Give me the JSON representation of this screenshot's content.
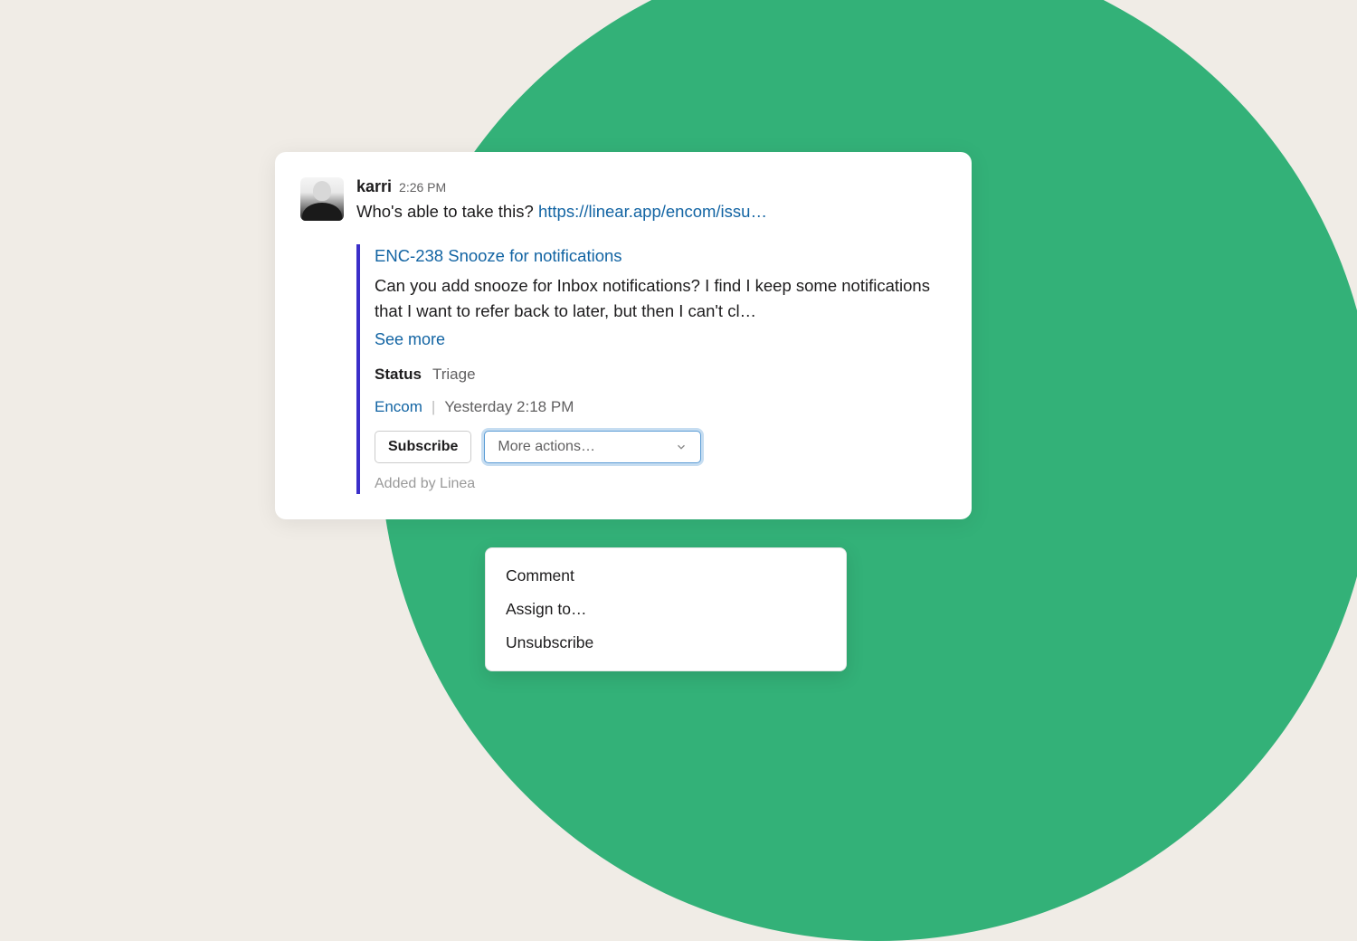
{
  "message": {
    "author": "karri",
    "time": "2:26 PM",
    "text": "Who's able to take this? ",
    "link": "https://linear.app/encom/issu…"
  },
  "attachment": {
    "title": "ENC-238 Snooze for notifications",
    "description": "Can you add snooze for Inbox notifications? I find I keep some notifications that I want to refer back to later, but then I can't cl…",
    "see_more": "See more",
    "status_label": "Status",
    "status_value": "Triage",
    "source_name": "Encom",
    "source_time": "Yesterday 2:18 PM",
    "subscribe_label": "Subscribe",
    "more_actions_label": "More actions…",
    "added_by": "Added by Linea"
  },
  "dropdown": {
    "items": [
      "Comment",
      "Assign to…",
      "Unsubscribe"
    ]
  }
}
